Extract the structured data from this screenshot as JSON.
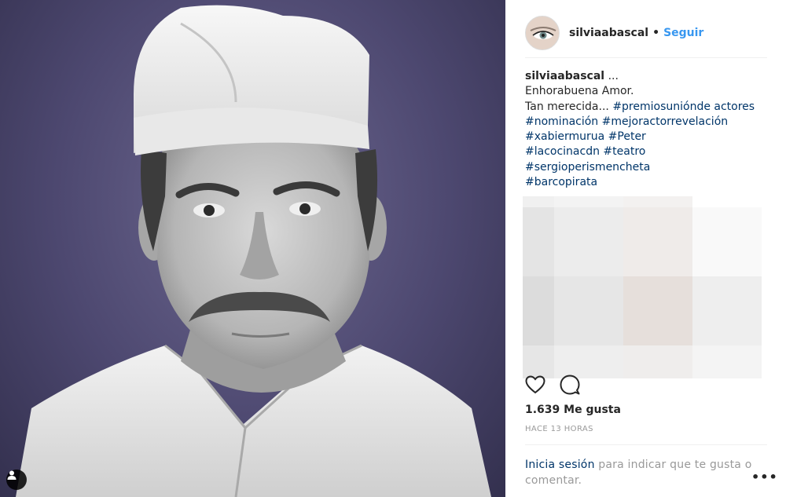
{
  "post": {
    "image_alt": "Retrato en blanco y negro de un hombre con bigote y gorro de cocinero",
    "username": "silviaabascal",
    "follow_label": "Seguir",
    "separator": "•",
    "caption": {
      "username": "silviaabascal",
      "ellipsis": "...",
      "line1": "Enhorabuena Amor.",
      "line2_text": "Tan merecida... ",
      "line2_tag": "#premiosuniónde actores",
      "tags_line3": [
        "#nominación",
        "#mejoractorrevelación"
      ],
      "tags_line4": [
        "#xabiermurua",
        "#Peter"
      ],
      "tags_line5": [
        "#lacocinacdn",
        "#teatro"
      ],
      "tags_line6": [
        "#sergioperismencheta"
      ],
      "tags_line7": [
        "#barcopirata"
      ]
    },
    "likes_text": "1.639 Me gusta",
    "time_text": "HACE 13 HORAS",
    "login_link": "Inicia sesión",
    "login_rest": " para indicar que te gusta o comentar.",
    "more_label": "•••"
  },
  "icons": {
    "like": "heart-icon",
    "comment": "comment-icon",
    "tag": "user-tag-icon",
    "more": "more-options-icon"
  },
  "colors": {
    "link_blue": "#3897f0",
    "hashtag": "#003569",
    "muted": "#999999",
    "text": "#262626"
  }
}
